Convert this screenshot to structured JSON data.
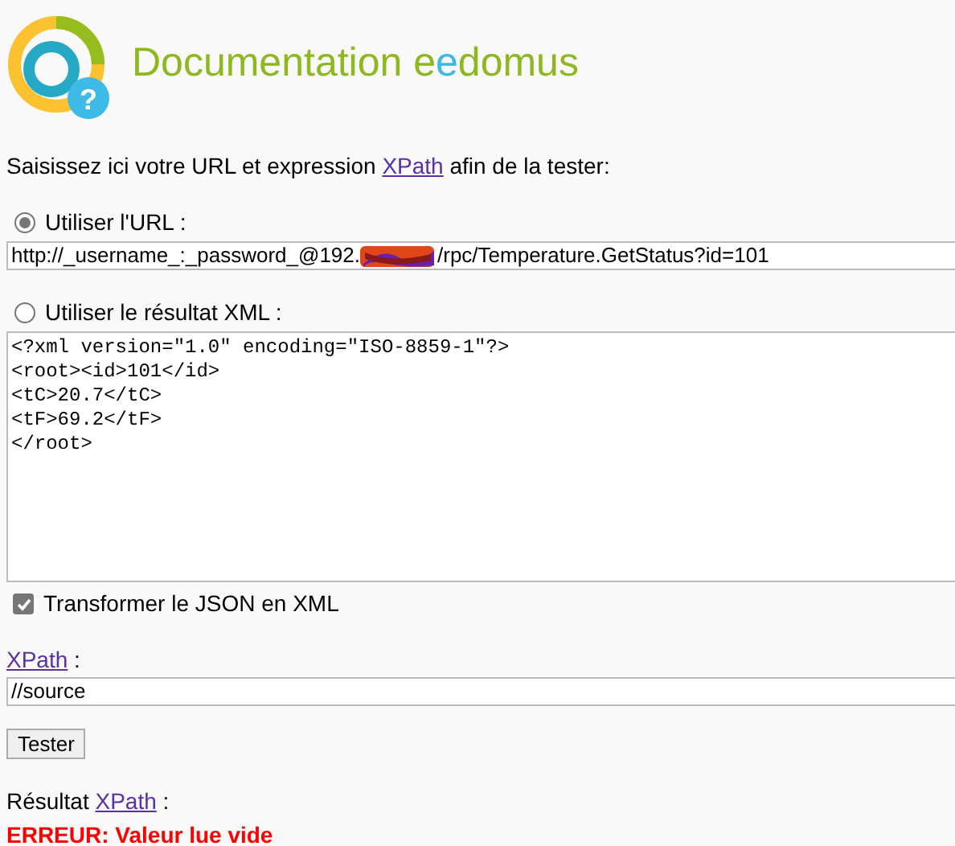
{
  "header": {
    "logo_mark": "?",
    "title": [
      {
        "text": "Documentation e",
        "color": "#8db81f"
      },
      {
        "text": "e",
        "color": "#3eb8e4"
      },
      {
        "text": "domus",
        "color": "#8db81f"
      }
    ]
  },
  "intro": {
    "before": "Saisissez ici votre URL et expression ",
    "link": "XPath",
    "after": " afin de la tester:"
  },
  "sources": [
    {
      "kind": "url",
      "label": "Utiliser l'URL :",
      "selected": true,
      "value_before": "http://_username_:_password_@192.",
      "value_after": "/rpc/Temperature.GetStatus?id=101"
    },
    {
      "kind": "xml",
      "label": "Utiliser le résultat XML :",
      "selected": false,
      "lines": [
        "<?xml version=\"1.0\" encoding=\"ISO-8859-1\"?>",
        "<root><id>101</id>",
        "<tC>20.7</tC>",
        "<tF>69.2</tF>",
        "</root>"
      ]
    }
  ],
  "transform": {
    "label": "Transformer le JSON en XML",
    "checked": true
  },
  "xpath": {
    "link": "XPath",
    "suffix": " :",
    "value": "//source"
  },
  "button": "Tester",
  "result": {
    "before": "Résultat ",
    "link": "XPath",
    "after": " :",
    "error": "ERREUR: Valeur lue vide"
  }
}
